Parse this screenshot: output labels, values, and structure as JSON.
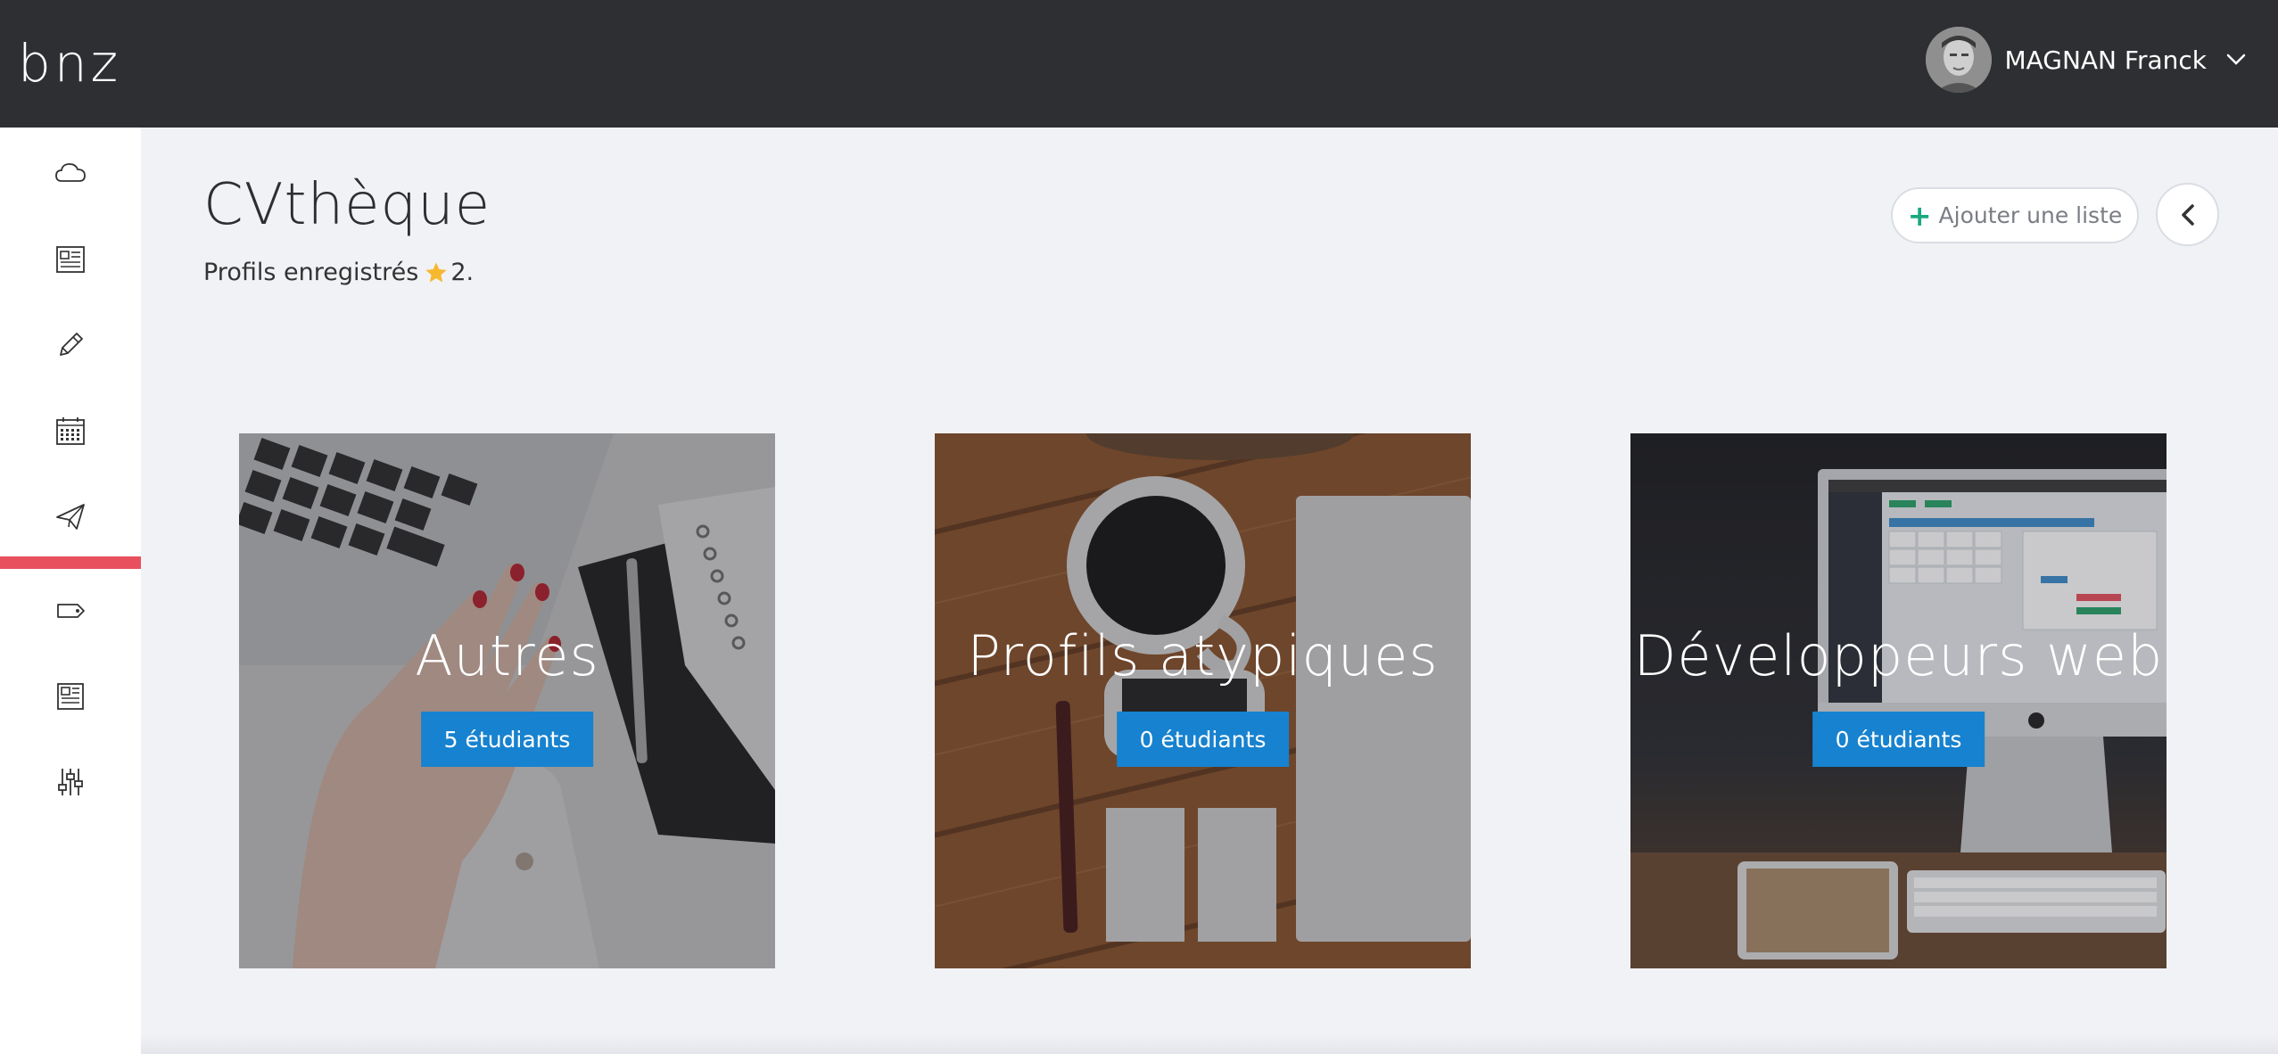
{
  "header": {
    "logo": "bnz",
    "user_name": "MAGNAN Franck"
  },
  "sidebar": {
    "items": [
      {
        "icon": "cloud-icon"
      },
      {
        "icon": "newspaper-icon"
      },
      {
        "icon": "pencil-icon"
      },
      {
        "icon": "calendar-icon"
      },
      {
        "icon": "paper-plane-icon",
        "active": true
      },
      {
        "icon": "tag-icon"
      },
      {
        "icon": "document-icon"
      },
      {
        "icon": "sliders-icon"
      }
    ],
    "active_color": "#e9505e"
  },
  "page": {
    "title": "CVthèque",
    "subtitle_prefix": "Profils enregistrés",
    "subtitle_count": "2.",
    "add_list_label": "Ajouter une liste"
  },
  "cards": [
    {
      "title": "Autres",
      "count_label": "5 étudiants"
    },
    {
      "title": "Profils atypiques",
      "count_label": "0 étudiants"
    },
    {
      "title": "Développeurs web",
      "count_label": "0 étudiants"
    }
  ],
  "colors": {
    "topbar": "#2e2f32",
    "accent_blue": "#1782cf",
    "accent_green": "#1aa980",
    "star": "#f5b82e"
  }
}
